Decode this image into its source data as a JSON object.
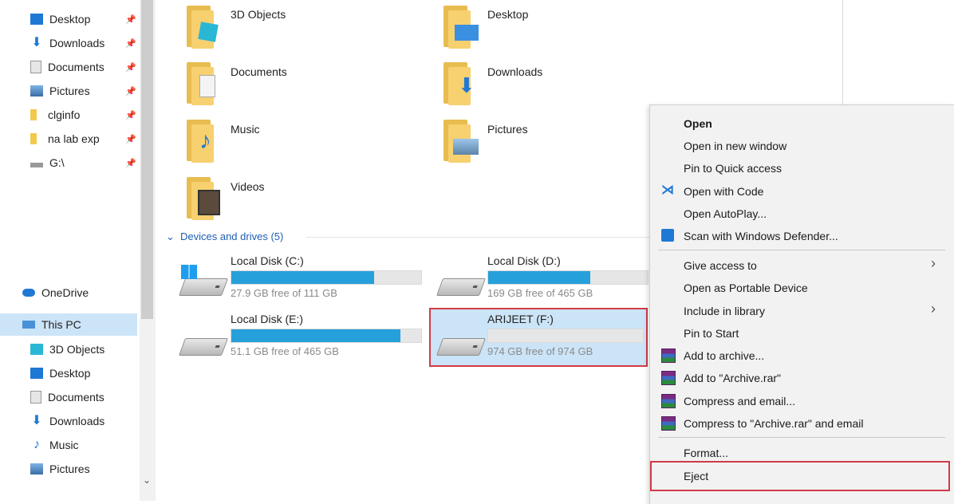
{
  "sidebar": {
    "quick_access": [
      {
        "label": "Desktop",
        "icon": "desktop-icon",
        "pinned": true
      },
      {
        "label": "Downloads",
        "icon": "downloads-icon",
        "pinned": true
      },
      {
        "label": "Documents",
        "icon": "documents-icon",
        "pinned": true
      },
      {
        "label": "Pictures",
        "icon": "pictures-icon",
        "pinned": true
      },
      {
        "label": "clginfo",
        "icon": "folder-icon",
        "pinned": true
      },
      {
        "label": "na lab exp",
        "icon": "folder-icon",
        "pinned": true
      },
      {
        "label": "G:\\",
        "icon": "drive-icon",
        "pinned": true
      }
    ],
    "onedrive": "OneDrive",
    "this_pc": "This PC",
    "this_pc_items": [
      {
        "label": "3D Objects",
        "icon": "3d-objects-icon"
      },
      {
        "label": "Desktop",
        "icon": "desktop-icon"
      },
      {
        "label": "Documents",
        "icon": "documents-icon"
      },
      {
        "label": "Downloads",
        "icon": "downloads-icon"
      },
      {
        "label": "Music",
        "icon": "music-icon"
      },
      {
        "label": "Pictures",
        "icon": "pictures-icon"
      }
    ],
    "pin_glyph": "📌"
  },
  "folders": [
    {
      "label": "3D Objects",
      "icon": "3d-objects-folder-icon"
    },
    {
      "label": "Desktop",
      "icon": "desktop-folder-icon"
    },
    {
      "label": "Documents",
      "icon": "documents-folder-icon"
    },
    {
      "label": "Downloads",
      "icon": "downloads-folder-icon"
    },
    {
      "label": "Music",
      "icon": "music-folder-icon"
    },
    {
      "label": "Pictures",
      "icon": "pictures-folder-icon"
    },
    {
      "label": "Videos",
      "icon": "videos-folder-icon"
    }
  ],
  "devices": {
    "header": "Devices and drives (5)",
    "drives": [
      {
        "name": "Local Disk (C:)",
        "free": "27.9 GB free of 111 GB",
        "used_fraction": 0.75,
        "windows_logo": true
      },
      {
        "name": "Local Disk (D:)",
        "free": "169 GB free of 465 GB",
        "used_fraction": 0.64
      },
      {
        "name": "Local Disk (E:)",
        "free": "51.1 GB free of 465 GB",
        "used_fraction": 0.89
      },
      {
        "name": "ARIJEET (F:)",
        "free": "974 GB free of 974 GB",
        "used_fraction": 0.0,
        "selected": true
      }
    ]
  },
  "context_menu": {
    "items": [
      {
        "label": "Open",
        "bold": true
      },
      {
        "label": "Open in new window"
      },
      {
        "label": "Pin to Quick access"
      },
      {
        "label": "Open with Code",
        "icon": "vscode-icon"
      },
      {
        "label": "Open AutoPlay..."
      },
      {
        "label": "Scan with Windows Defender...",
        "icon": "windows-defender-icon"
      },
      {
        "label": "Give access to",
        "submenu": true
      },
      {
        "label": "Open as Portable Device"
      },
      {
        "label": "Include in library",
        "submenu": true
      },
      {
        "label": "Pin to Start"
      },
      {
        "label": "Add to archive...",
        "icon": "winrar-icon"
      },
      {
        "label": "Add to \"Archive.rar\"",
        "icon": "winrar-icon"
      },
      {
        "label": "Compress and email...",
        "icon": "winrar-icon"
      },
      {
        "label": "Compress to \"Archive.rar\" and email",
        "icon": "winrar-icon"
      },
      {
        "label": "Format..."
      },
      {
        "label": "Eject",
        "highlighted": true
      }
    ],
    "chevron_glyph": "›"
  },
  "colors": {
    "highlight_box": "#d23a47",
    "drive_bar": "#26a0da",
    "selection": "#cce4f7",
    "folder": "#f7d070"
  }
}
